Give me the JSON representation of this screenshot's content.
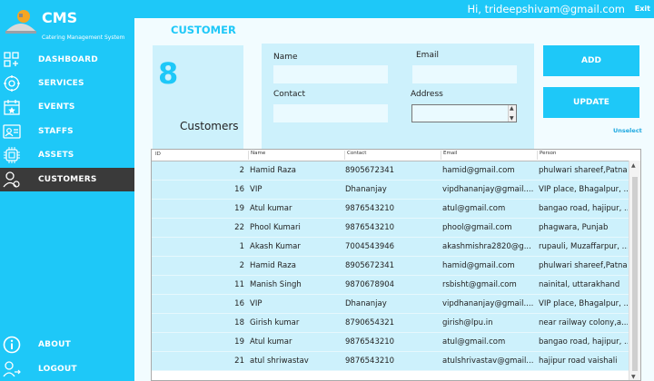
{
  "app": {
    "title": "CMS",
    "subtitle": "Catering Management System"
  },
  "nav": {
    "items": [
      {
        "label": "DASHBOARD",
        "icon": "dashboard-grid-icon",
        "active": false
      },
      {
        "label": "SERVICES",
        "icon": "services-gear-icon",
        "active": false
      },
      {
        "label": "EVENTS",
        "icon": "calendar-icon",
        "active": false
      },
      {
        "label": "STAFFS",
        "icon": "staff-icon",
        "active": false
      },
      {
        "label": "ASSETS",
        "icon": "assets-chip-icon",
        "active": false
      },
      {
        "label": "CUSTOMERS",
        "icon": "customer-user-icon",
        "active": true
      }
    ],
    "about": {
      "label": "ABOUT",
      "icon": "info-icon"
    },
    "logout": {
      "label": "LOGOUT",
      "icon": "logout-user-icon"
    }
  },
  "topbar": {
    "user": "Hi, trideepshivam@gmail.com",
    "exit_label": "Exit"
  },
  "page": {
    "title": "CUSTOMER"
  },
  "summary": {
    "count": "8",
    "label": "Customers"
  },
  "form": {
    "name_label": "Name",
    "name_value": "",
    "email_label": "Email",
    "email_value": "",
    "contact_label": "Contact",
    "contact_value": "",
    "address_label": "Address",
    "address_value": ""
  },
  "buttons": {
    "add": "ADD",
    "update": "UPDATE",
    "unselect": "Unselect"
  },
  "table": {
    "headers": [
      "ID",
      "Name",
      "Contact",
      "Email",
      "Person"
    ],
    "rows": [
      [
        "2",
        "Hamid Raza",
        "8905672341",
        "hamid@gmail.com",
        "phulwari shareef,Patna"
      ],
      [
        "16",
        "VIP",
        "Dhananjay",
        "vipdhananjay@gmail....",
        "VIP place, Bhagalpur, ..."
      ],
      [
        "19",
        "Atul kumar",
        "9876543210",
        "atul@gmail.com",
        "bangao road, hajipur, ..."
      ],
      [
        "22",
        "Phool Kumari",
        "9876543210",
        "phool@gmail.com",
        "phagwara, Punjab"
      ],
      [
        "1",
        "Akash Kumar",
        "7004543946",
        "akashmishra2820@g...",
        "rupauli, Muzaffarpur, ..."
      ],
      [
        "2",
        "Hamid Raza",
        "8905672341",
        "hamid@gmail.com",
        "phulwari shareef,Patna"
      ],
      [
        "11",
        "Manish Singh",
        "9870678904",
        "rsbisht@gmail.com",
        "nainital, uttarakhand"
      ],
      [
        "16",
        "VIP",
        "Dhananjay",
        "vipdhananjay@gmail....",
        "VIP place, Bhagalpur, ..."
      ],
      [
        "18",
        "Girish kumar",
        "8790654321",
        "girish@lpu.in",
        "near railway colony,a..."
      ],
      [
        "19",
        "Atul kumar",
        "9876543210",
        "atul@gmail.com",
        "bangao road, hajipur, ..."
      ],
      [
        "21",
        "atul shriwastav",
        "9876543210",
        "atulshrivastav@gmail....",
        "hajipur road vaishali"
      ]
    ]
  },
  "colors": {
    "accent": "#1ec8f8",
    "panel": "#cdf1fc",
    "active_nav": "#3a3a3a"
  }
}
